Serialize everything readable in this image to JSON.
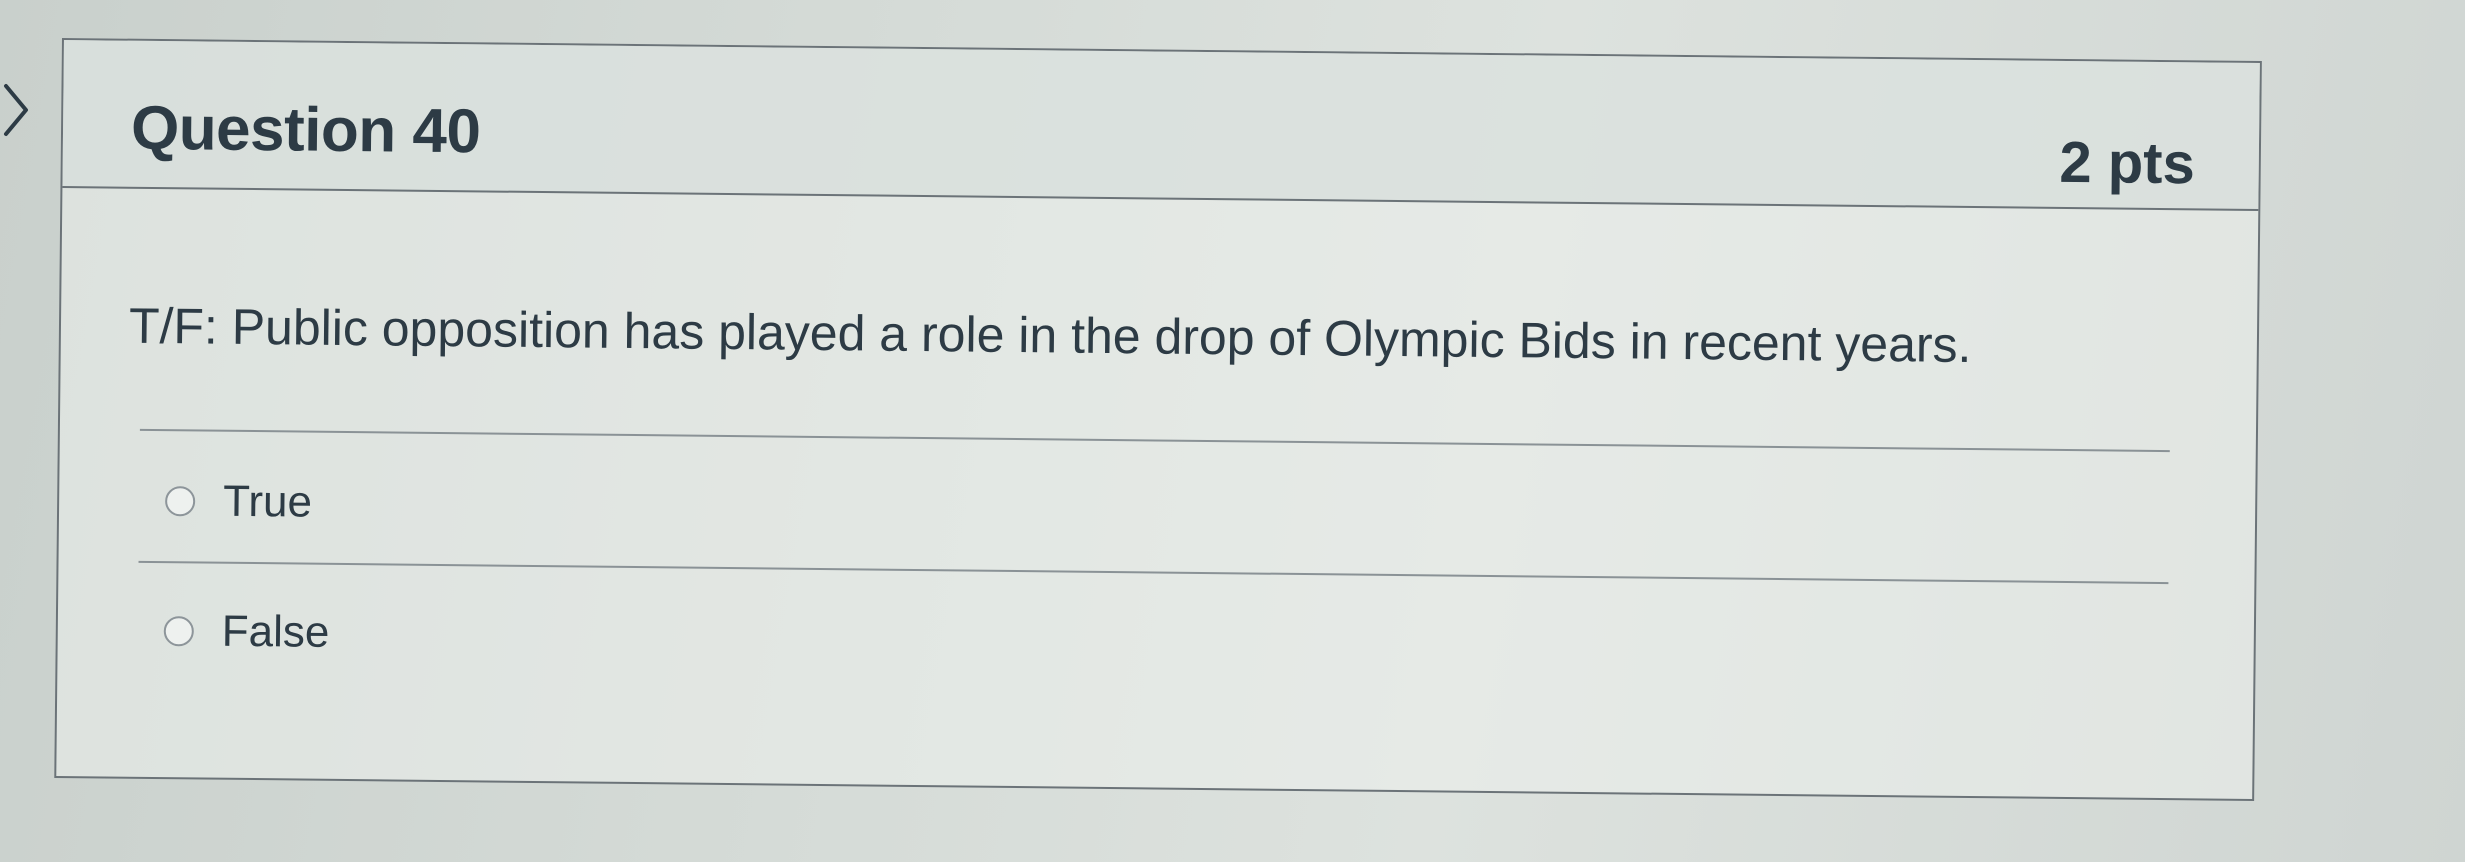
{
  "question": {
    "title": "Question 40",
    "points": "2 pts",
    "text": "T/F: Public opposition has played a role in the drop of Olympic Bids in recent years."
  },
  "answers": [
    {
      "label": "True",
      "selected": false
    },
    {
      "label": "False",
      "selected": false
    }
  ],
  "icons": {
    "nav": "chevron-right-icon",
    "answer_control": "radio-button"
  },
  "colors": {
    "text": "#2d3b45",
    "border": "#6b7378",
    "header_bg": "#d6ddda"
  }
}
